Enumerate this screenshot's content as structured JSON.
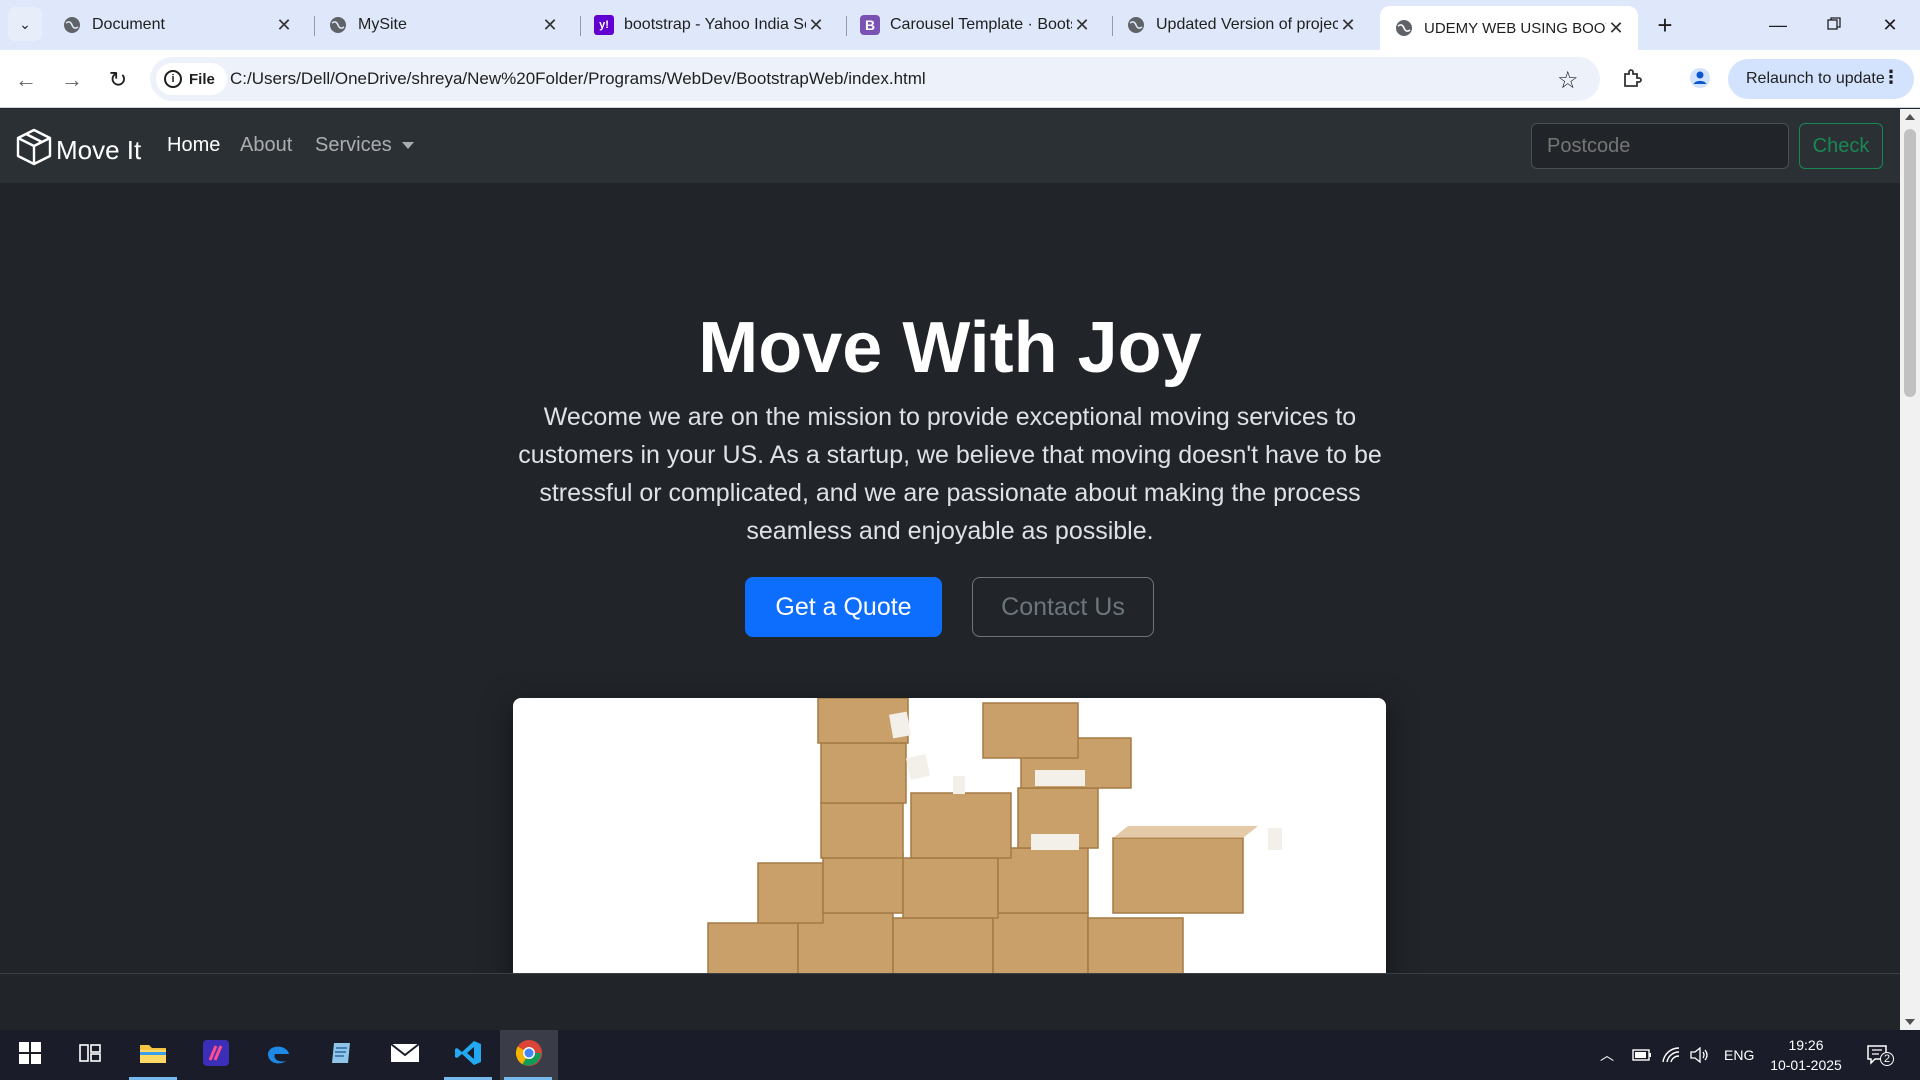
{
  "browser": {
    "tabs": [
      {
        "title": "Document",
        "favicon": "globe-icon"
      },
      {
        "title": "MySite",
        "favicon": "globe-icon"
      },
      {
        "title": "bootstrap - Yahoo India Se",
        "favicon": "yahoo-icon"
      },
      {
        "title": "Carousel Template · Bootst",
        "favicon": "bootstrap-icon"
      },
      {
        "title": "Updated Version of project",
        "favicon": "globe-icon"
      },
      {
        "title": "UDEMY WEB USING BOOT",
        "favicon": "globe-icon",
        "active": true
      }
    ],
    "address_chip": "File",
    "url": "C:/Users/Dell/OneDrive/shreya/New%20Folder/Programs/WebDev/BootstrapWeb/index.html",
    "relaunch_label": "Relaunch to update",
    "yahoo_glyph": "y!",
    "bootstrap_glyph": "B"
  },
  "site": {
    "brand": "Move It",
    "nav": {
      "home": "Home",
      "about": "About",
      "services": "Services"
    },
    "search_placeholder": "Postcode",
    "check_label": "Check",
    "hero": {
      "title": "Move With Joy",
      "text": "Wecome we are on the mission to provide exceptional moving services to customers in your US. As a startup, we believe that moving doesn't have to be stressful or complicated, and we are passionate about making the process seamless and enjoyable as possible.",
      "primary_button": "Get a Quote",
      "secondary_button": "Contact Us"
    },
    "colors": {
      "primary": "#0d6efd",
      "success": "#198754",
      "background": "#212529",
      "navbar": "#2b3035"
    }
  },
  "taskbar": {
    "apps": [
      "windows-start-icon",
      "task-view-icon",
      "file-explorer-icon",
      "app-icon",
      "edge-icon",
      "notepad-icon",
      "mail-icon",
      "vscode-icon",
      "chrome-icon"
    ],
    "language": "ENG",
    "time": "19:26",
    "date": "10-01-2025",
    "notification_count": "2"
  }
}
